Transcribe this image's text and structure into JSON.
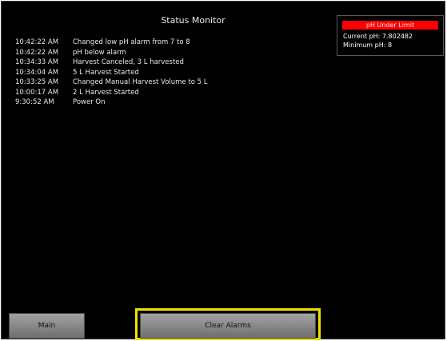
{
  "header": {
    "title": "Status Monitor"
  },
  "log": [
    {
      "time": "10:42:22 AM",
      "message": "Changed low pH alarm from 7 to 8"
    },
    {
      "time": "10:42:22 AM",
      "message": "pH below alarm"
    },
    {
      "time": "10:34:33 AM",
      "message": "Harvest Canceled, 3 L harvested"
    },
    {
      "time": "10:34:04 AM",
      "message": "5 L Harvest Started"
    },
    {
      "time": "10:33:25 AM",
      "message": "Changed Manual Harvest Volume to 5 L"
    },
    {
      "time": "10:00:17 AM",
      "message": "2 L Harvest Started"
    },
    {
      "time": "9:30:52 AM",
      "message": "Power On"
    }
  ],
  "alarm": {
    "label": "pH Under Limit",
    "current": "Current pH: 7.802482",
    "minimum": "Minimum pH: 8",
    "color": "#ff0000"
  },
  "buttons": {
    "main": "Main",
    "clear_alarms": "Clear Alarms",
    "highlight_color": "#f0e000"
  }
}
